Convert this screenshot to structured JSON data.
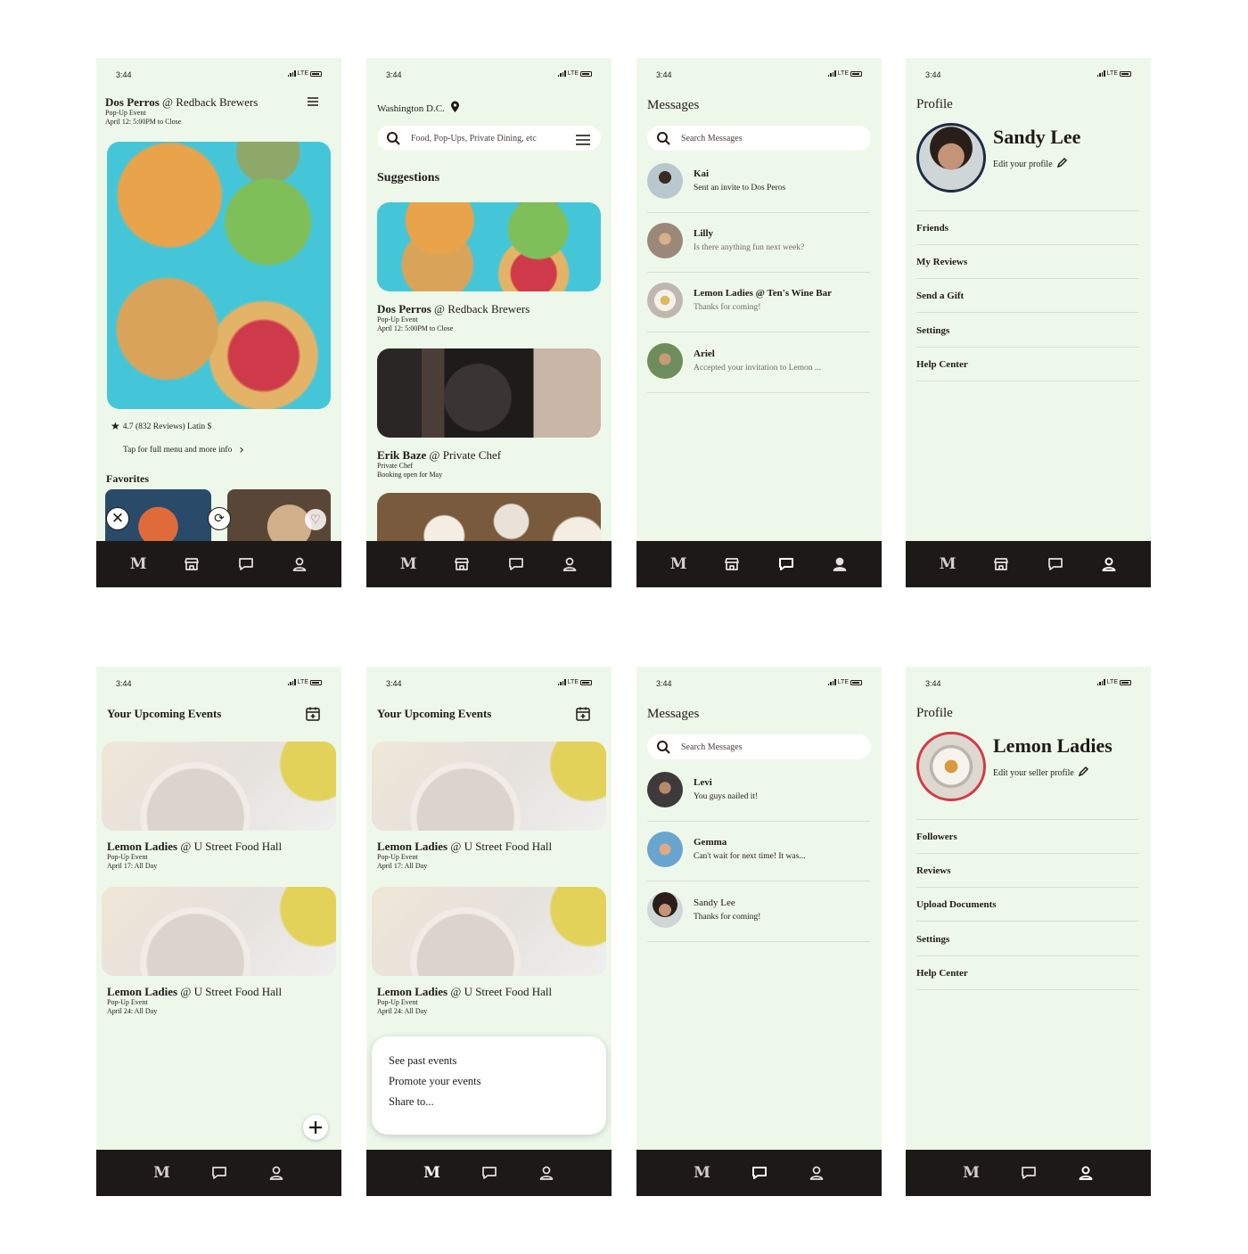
{
  "status": {
    "time": "3:44",
    "network": "LTE"
  },
  "nav": {
    "logo": "M"
  },
  "colors": {
    "background": "#eef8ea",
    "navbar": "#1d1918",
    "accent_ring": "#d33a45"
  },
  "screen1": {
    "title_bold": "Dos Perros",
    "title_rest": " @ Redback Brewers",
    "type": "Pop-Up Event",
    "date": "April 12: 5:00PM to Close",
    "rating": "4.7 (832 Reviews) Latin $",
    "more_info": "Tap for full menu and more info",
    "favorites_label": "Favorites"
  },
  "screen2": {
    "location": "Washington D.C.",
    "search_placeholder": "Food, Pop-Ups, Private Dining, etc",
    "suggestions_label": "Suggestions",
    "items": [
      {
        "bold": "Dos Perros",
        "rest": " @ Redback Brewers",
        "type": "Pop-Up Event",
        "date": "April 12: 5:00PM to Close"
      },
      {
        "bold": "Erik Baze",
        "rest": " @ Private Chef",
        "type": "Private Chef",
        "date": "Booking open for May"
      }
    ]
  },
  "screen3": {
    "title": "Messages",
    "search_placeholder": "Search Messages",
    "messages": [
      {
        "name": "Kai",
        "text": "Sent an invite to Dos Peros"
      },
      {
        "name": "Lilly",
        "text": "Is there anything fun next week?"
      },
      {
        "name": "Lemon Ladies @ Ten's Wine Bar",
        "text": "Thanks for coming!"
      },
      {
        "name": "Ariel",
        "text": "Accepted your invitation to Lemon ..."
      }
    ]
  },
  "screen4": {
    "title": "Profile",
    "name": "Sandy Lee",
    "edit": "Edit your profile",
    "menu": [
      "Friends",
      "My Reviews",
      "Send a Gift",
      "Settings",
      "Help Center"
    ]
  },
  "screen5": {
    "title": "Your Upcoming Events",
    "events": [
      {
        "bold": "Lemon Ladies",
        "rest": " @ U Street Food Hall",
        "type": "Pop-Up Event",
        "date": "April 17: All Day"
      },
      {
        "bold": "Lemon Ladies",
        "rest": " @ U Street Food Hall",
        "type": "Pop-Up Event",
        "date": "April 24: All Day"
      }
    ]
  },
  "screen6": {
    "title": "Your Upcoming Events",
    "events": [
      {
        "bold": "Lemon Ladies",
        "rest": " @ U Street Food Hall",
        "type": "Pop-Up Event",
        "date": "April 17: All Day"
      },
      {
        "bold": "Lemon Ladies",
        "rest": " @ U Street Food Hall",
        "type": "Pop-Up Event",
        "date": "April 24: All Day"
      }
    ],
    "popup": [
      "See past events",
      "Promote your events",
      "Share to..."
    ]
  },
  "screen7": {
    "title": "Messages",
    "search_placeholder": "Search Messages",
    "messages": [
      {
        "name": "Levi",
        "text": "You guys nailed it!"
      },
      {
        "name": "Gemma",
        "text": "Can't wait for next time! It was..."
      },
      {
        "name": "Sandy Lee",
        "text": "Thanks for coming!"
      }
    ]
  },
  "screen8": {
    "title": "Profile",
    "name": "Lemon Ladies",
    "edit": "Edit your seller profile",
    "menu": [
      "Followers",
      "Reviews",
      "Upload Documents",
      "Settings",
      "Help Center"
    ]
  }
}
